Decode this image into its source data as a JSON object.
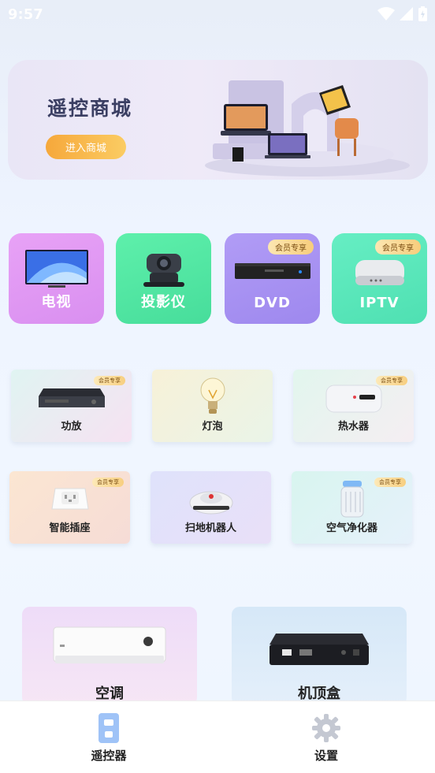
{
  "status_bar": {
    "time": "9:57"
  },
  "banner": {
    "title": "遥控商城",
    "button_label": "进入商城"
  },
  "categories": [
    {
      "label": "电视"
    },
    {
      "label": "投影仪"
    },
    {
      "label": "DVD",
      "badge": "会员专享"
    },
    {
      "label": "IPTV",
      "badge": "会员专享"
    }
  ],
  "devices_row1": [
    {
      "label": "功放",
      "badge": "会员专享"
    },
    {
      "label": "灯泡"
    },
    {
      "label": "热水器",
      "badge": "会员专享"
    }
  ],
  "devices_row2": [
    {
      "label": "智能插座",
      "badge": "会员专享"
    },
    {
      "label": "扫地机器人"
    },
    {
      "label": "空气净化器",
      "badge": "会员专享"
    }
  ],
  "featured": [
    {
      "label": "空调"
    },
    {
      "label": "机顶盒"
    }
  ],
  "tabbar": [
    {
      "label": "遥控器"
    },
    {
      "label": "设置"
    }
  ],
  "colors": {
    "tv_tile": "#e398f2",
    "projector_tile": "#52e7a5",
    "dvd_tile": "#a993f3",
    "iptv_tile": "#5de8bb",
    "vip_badge": "#f7cd7c"
  }
}
